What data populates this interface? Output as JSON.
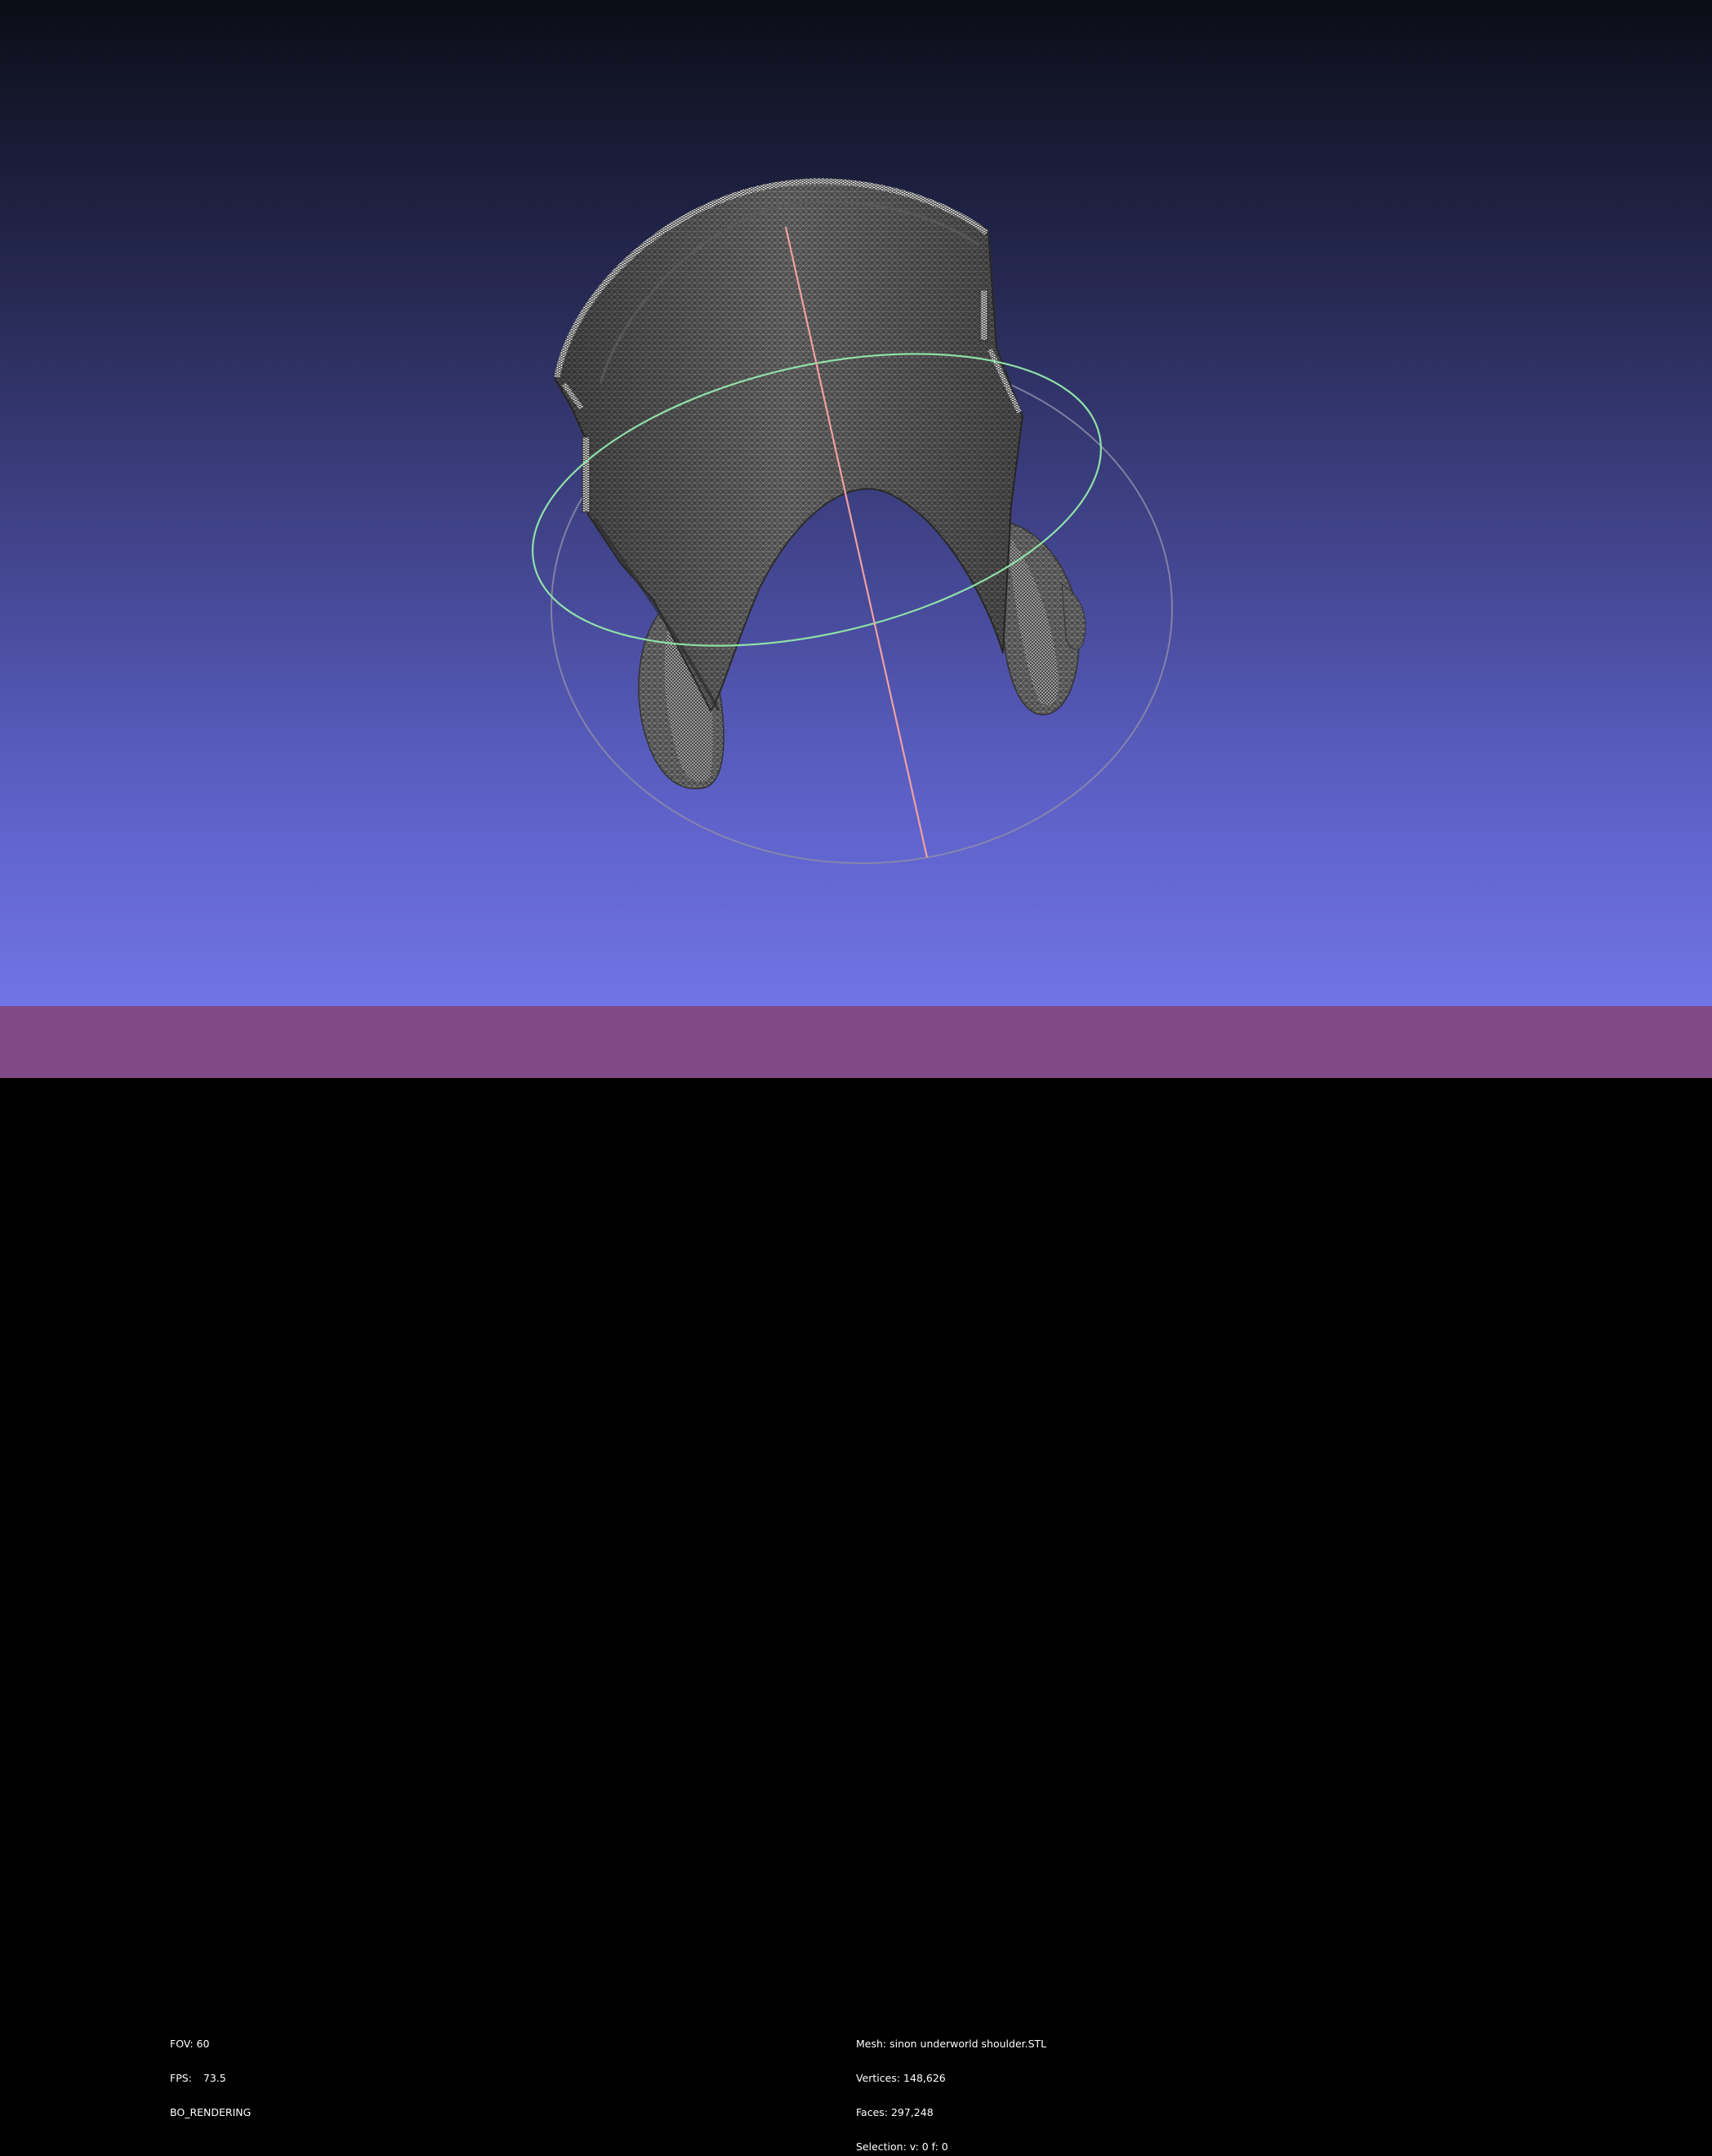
{
  "viewer": {
    "fov_label": "FOV:",
    "fov_value": "60",
    "fps_label": "FPS:",
    "fps_value": "73.5",
    "render_mode": "BO_RENDERING"
  },
  "mesh_info": {
    "mesh_line": "Mesh: sinon underworld shoulder.STL",
    "vertices_line": "Vertices: 148,626",
    "faces_line": "Faces: 297,248",
    "selection_line": "Selection: v: 0 f: 0"
  },
  "colors": {
    "status_bar": "#7f4a86",
    "mesh_fill": "#4a4a4a",
    "wire": "#c8c8c8",
    "trackball_green": "#8fe0a8",
    "trackball_red": "#f0a0a0",
    "trackball_gray": "#8c8ca8"
  }
}
